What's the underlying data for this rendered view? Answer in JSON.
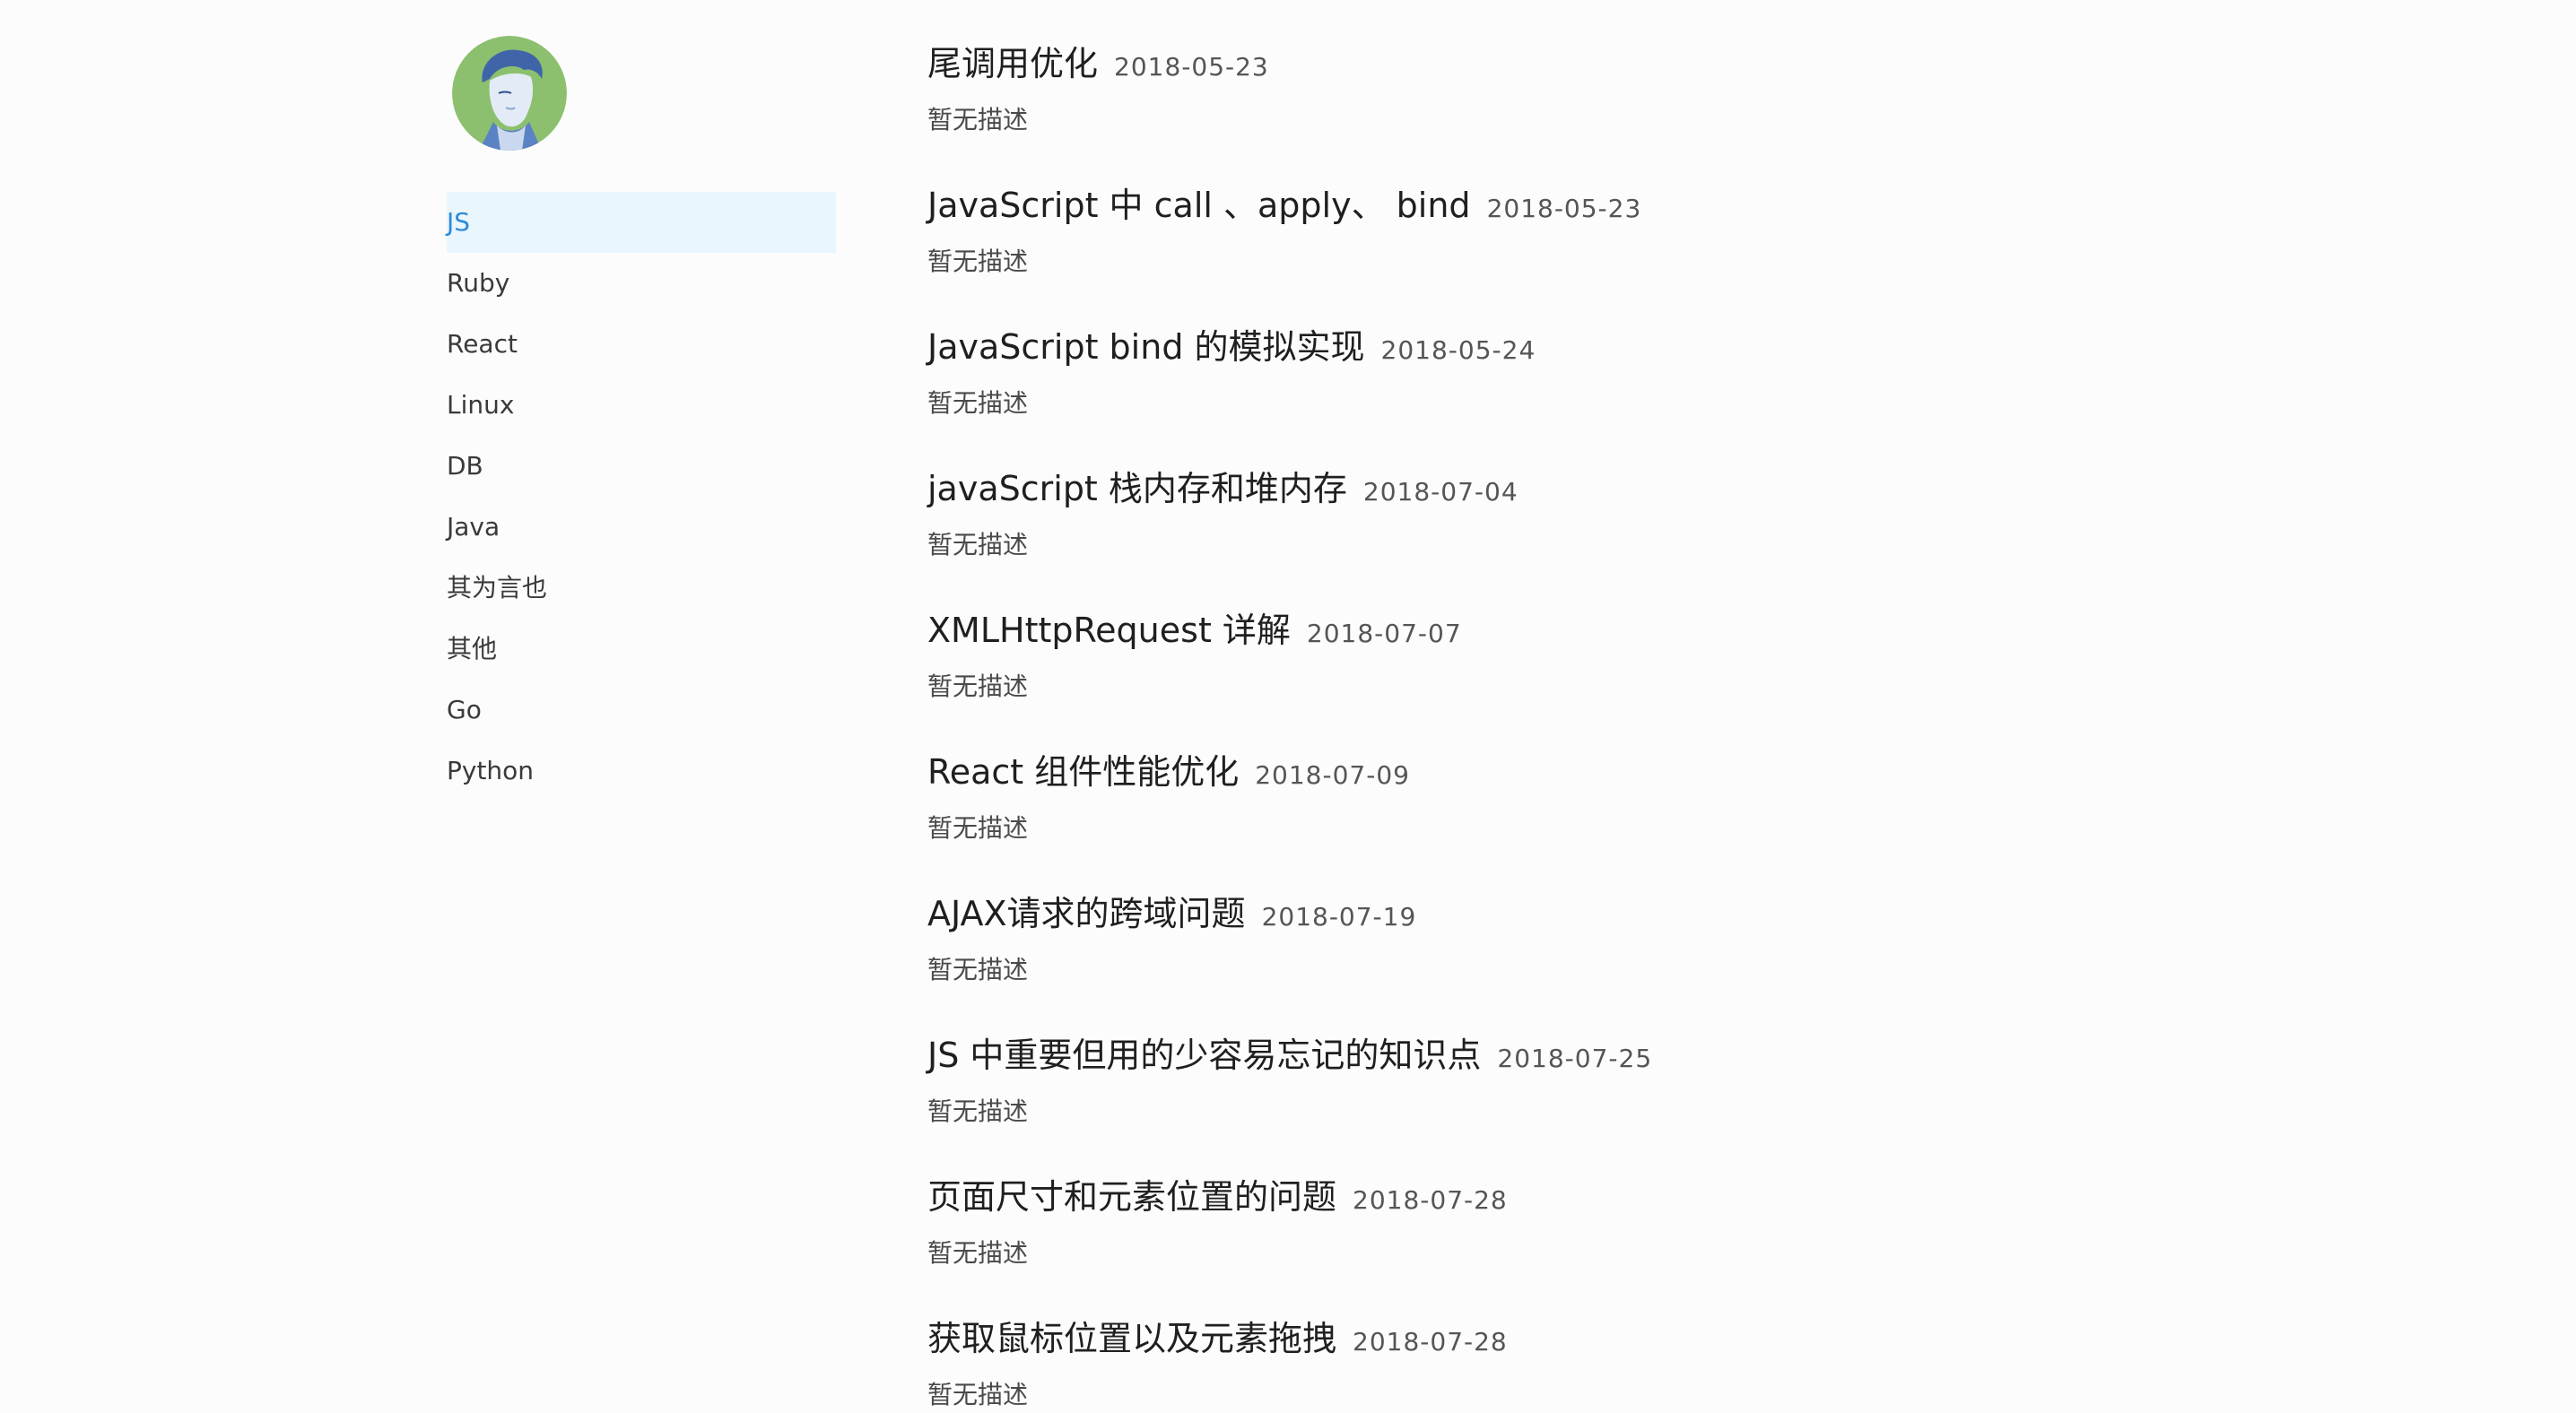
{
  "sidebar": {
    "avatar": "avatar",
    "items": [
      {
        "label": "JS",
        "active": true
      },
      {
        "label": "Ruby",
        "active": false
      },
      {
        "label": "React",
        "active": false
      },
      {
        "label": "Linux",
        "active": false
      },
      {
        "label": "DB",
        "active": false
      },
      {
        "label": "Java",
        "active": false
      },
      {
        "label": "其为言也",
        "active": false
      },
      {
        "label": "其他",
        "active": false
      },
      {
        "label": "Go",
        "active": false
      },
      {
        "label": "Python",
        "active": false
      }
    ],
    "active_color": "#2f8ad6",
    "active_bg": "#e9f6fe"
  },
  "posts": [
    {
      "title": "尾调用优化",
      "date": "2018-05-23",
      "desc": "暂无描述"
    },
    {
      "title": "JavaScript 中 call 、apply、 bind",
      "date": "2018-05-23",
      "desc": "暂无描述"
    },
    {
      "title": "JavaScript bind 的模拟实现",
      "date": "2018-05-24",
      "desc": "暂无描述"
    },
    {
      "title": "javaScript 栈内存和堆内存",
      "date": "2018-07-04",
      "desc": "暂无描述"
    },
    {
      "title": "XMLHttpRequest 详解",
      "date": "2018-07-07",
      "desc": "暂无描述"
    },
    {
      "title": "React 组件性能优化",
      "date": "2018-07-09",
      "desc": "暂无描述"
    },
    {
      "title": "AJAX请求的跨域问题",
      "date": "2018-07-19",
      "desc": "暂无描述"
    },
    {
      "title": "JS 中重要但用的少容易忘记的知识点",
      "date": "2018-07-25",
      "desc": "暂无描述"
    },
    {
      "title": "页面尺寸和元素位置的问题",
      "date": "2018-07-28",
      "desc": "暂无描述"
    },
    {
      "title": "获取鼠标位置以及元素拖拽",
      "date": "2018-07-28",
      "desc": "暂无描述"
    }
  ]
}
